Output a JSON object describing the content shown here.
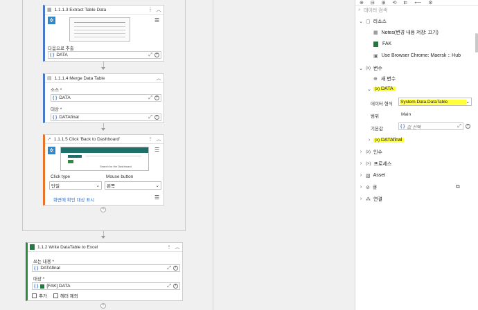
{
  "activities": {
    "extract": {
      "title": "1.1.1.3  Extract Table Data",
      "target_label": "다음으로 추출",
      "target_value": "DATA"
    },
    "merge": {
      "title": "1.1.1.4  Merge Data Table",
      "source_label": "소스 *",
      "source_value": "DATA",
      "dest_label": "대상 *",
      "dest_value": "DATAfinal"
    },
    "click": {
      "title": "1.1.1.5  Click 'Back to Dashboard'",
      "click_type_label": "Click type",
      "click_type_value": "단일",
      "mouse_button_label": "Mouse button",
      "mouse_button_value": "왼쪽",
      "show_target_link": "화면에 확인 대상 표시",
      "thumb_caption": "Search for the Dashboard"
    },
    "write": {
      "title": "1.1.2  Write DataTable to Excel",
      "content_label": "쓰는 내용 *",
      "content_value": "DATAfinal",
      "dest_label": "대상 *",
      "dest_value": "[FAK] DATA",
      "append_label": "추가",
      "exclude_header_label": "헤더 제외"
    }
  },
  "panel": {
    "search_placeholder": "데이터 검색",
    "resources": {
      "label": "리소스",
      "items": [
        "Notes(변경 내용 저장: 끄기)",
        "FAK",
        "Use Browser Chrome: Maersk :: Hub"
      ]
    },
    "variables": {
      "label": "변수",
      "new_var": "새 변수",
      "data_var": "DATA",
      "type_label": "데이터 형식",
      "type_value": "System.Data.DataTable",
      "scope_label": "범위",
      "scope_value": "Main",
      "default_label": "기본값",
      "default_placeholder": "값 선택",
      "datafinal_var": "DATAfinal"
    },
    "args_label": "인수",
    "process_label": "프로세스",
    "asset_label": "Asset",
    "queue_label": "큐",
    "connection_label": "연결"
  },
  "colors": {
    "accent_blue": "#4a78c8",
    "highlight": "#ffff3a",
    "excel_green": "#2e8b3e"
  }
}
